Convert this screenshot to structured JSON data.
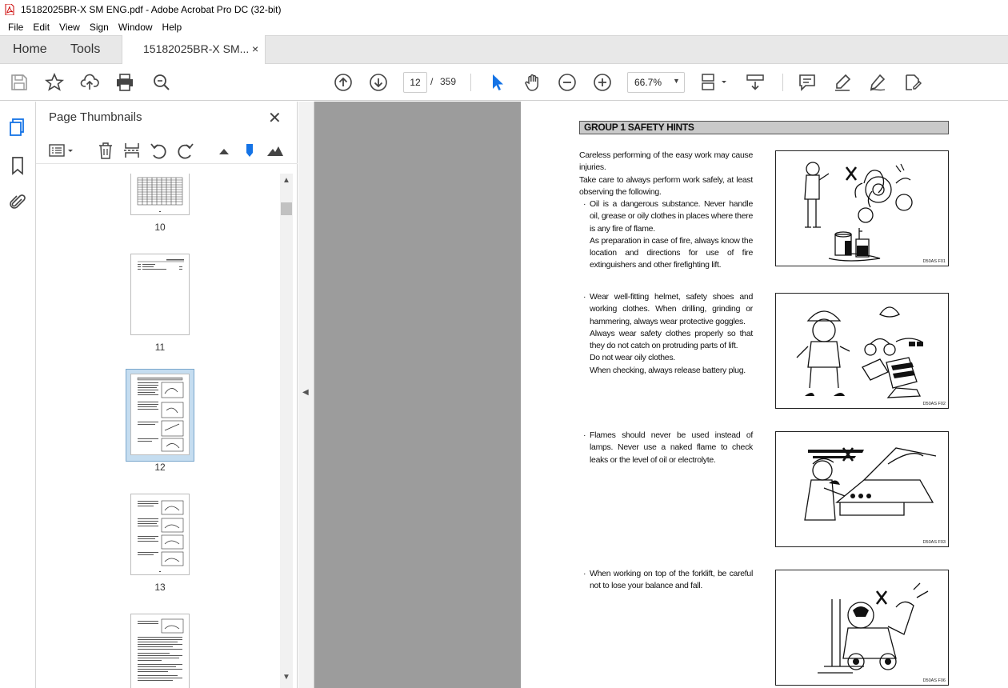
{
  "window": {
    "title": "15182025BR-X SM ENG.pdf - Adobe Acrobat Pro DC (32-bit)"
  },
  "menu": [
    "File",
    "Edit",
    "View",
    "Sign",
    "Window",
    "Help"
  ],
  "tabs": {
    "home": "Home",
    "tools": "Tools",
    "document": "15182025BR-X SM...",
    "close": "×"
  },
  "toolbar": {
    "current_page": "12",
    "separator": "/",
    "total_pages": "359",
    "zoom": "66.7%",
    "zoom_caret": "▼"
  },
  "thumbnails_panel": {
    "title": "Page Thumbnails",
    "close": "✕",
    "pages": [
      {
        "num": "10",
        "selected": false
      },
      {
        "num": "11",
        "selected": false
      },
      {
        "num": "12",
        "selected": true
      },
      {
        "num": "13",
        "selected": false
      }
    ]
  },
  "page": {
    "heading": "GROUP 1 SAFETY HINTS",
    "sections": [
      {
        "text": "Careless performing of the easy work may cause injuries.\nTake care to always perform work safely, at least observing the following.",
        "bullet": "Oil is a dangerous substance. Never handle oil, grease or oily clothes in places where there is any fire of flame.\nAs preparation in case of fire, always know the location and directions for use of fire extinguishers and other firefighting lift.",
        "figure_code": "D50AS F01"
      },
      {
        "bullet": "Wear well-fitting helmet, safety shoes and working clothes. When drilling, grinding or hammering, always wear protective goggles.\nAlways wear safety clothes properly so that they do not catch on protruding parts of lift.\nDo not wear oily clothes.\nWhen checking, always release battery plug.",
        "figure_code": "D50AS F02"
      },
      {
        "bullet": "Flames should never be used instead of lamps. Never use a naked flame to check leaks or the level of oil or electrolyte.",
        "figure_code": "D50AS F03"
      },
      {
        "bullet": "When working on top of the forklift, be careful not to lose your balance and fall.",
        "figure_code": "D50AS F06"
      }
    ]
  },
  "icons": {
    "save": "save-icon",
    "bookmark": "star-icon",
    "share": "upload-icon",
    "print": "printer-icon",
    "search": "zoom-search-icon"
  }
}
